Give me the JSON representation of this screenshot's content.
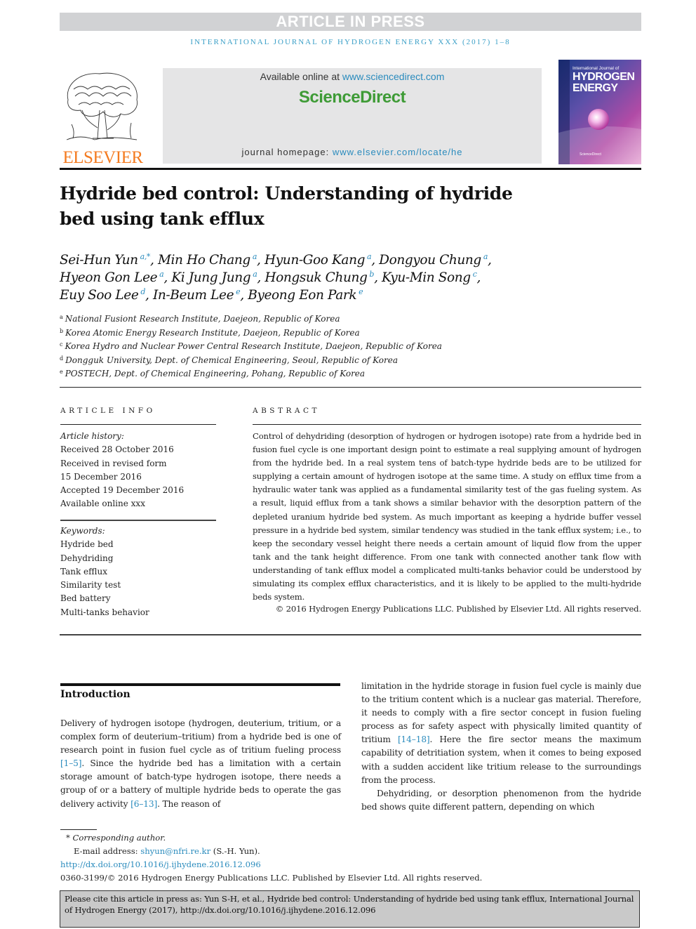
{
  "banner": {
    "label": "ARTICLE IN PRESS"
  },
  "journal_line": "International Journal of Hydrogen Energy xxx (2017) 1–8",
  "header": {
    "publisher_wordmark": "ELSEVIER",
    "available_prefix": "Available online at ",
    "available_link": "www.sciencedirect.com",
    "platform_logo": "ScienceDirect",
    "homepage_prefix": "journal homepage: ",
    "homepage_link": "www.elsevier.com/locate/he",
    "cover": {
      "line1": "International Journal of",
      "line2": "HYDROGEN",
      "line3": "ENERGY",
      "footer": "ScienceDirect"
    }
  },
  "title": {
    "line1": "Hydride bed control: Understanding of hydride",
    "line2": "bed using tank efflux"
  },
  "authors": [
    {
      "name": "Sei-Hun Yun",
      "aff": "a,*",
      "sep": ", "
    },
    {
      "name": "Min Ho Chang",
      "aff": "a",
      "sep": ", "
    },
    {
      "name": "Hyun-Goo Kang",
      "aff": "a",
      "sep": ", "
    },
    {
      "name": "Dongyou Chung",
      "aff": "a",
      "sep": ","
    },
    {
      "name": "Hyeon Gon Lee",
      "aff": "a",
      "sep": ", "
    },
    {
      "name": "Ki Jung Jung",
      "aff": "a",
      "sep": ", "
    },
    {
      "name": "Hongsuk Chung",
      "aff": "b",
      "sep": ", "
    },
    {
      "name": "Kyu-Min Song",
      "aff": "c",
      "sep": ","
    },
    {
      "name": "Euy Soo Lee",
      "aff": "d",
      "sep": ", "
    },
    {
      "name": "In-Beum Lee",
      "aff": "e",
      "sep": ", "
    },
    {
      "name": "Byeong Eon Park",
      "aff": "e",
      "sep": ""
    }
  ],
  "affiliations": [
    {
      "key": "a",
      "text": "National Fusiont Research Institute, Daejeon, Republic of Korea"
    },
    {
      "key": "b",
      "text": "Korea Atomic Energy Research Institute, Daejeon, Republic of Korea"
    },
    {
      "key": "c",
      "text": "Korea Hydro and Nuclear Power Central Research Institute, Daejeon, Republic of Korea"
    },
    {
      "key": "d",
      "text": "Dongguk University, Dept. of Chemical Engineering, Seoul, Republic of Korea"
    },
    {
      "key": "e",
      "text": "POSTECH, Dept. of Chemical Engineering, Pohang, Republic of Korea"
    }
  ],
  "article_info": {
    "heading": "ARTICLE INFO",
    "history_label": "Article history:",
    "history": [
      "Received 28 October 2016",
      "Received in revised form",
      "15 December 2016",
      "Accepted 19 December 2016",
      "Available online xxx"
    ],
    "keywords_label": "Keywords:",
    "keywords": [
      "Hydride bed",
      "Dehydriding",
      "Tank efflux",
      "Similarity test",
      "Bed battery",
      "Multi-tanks behavior"
    ]
  },
  "abstract": {
    "heading": "ABSTRACT",
    "text": "Control of dehydriding (desorption of hydrogen or hydrogen isotope) rate from a hydride bed in fusion fuel cycle is one important design point to estimate a real supplying amount of hydrogen from the hydride bed. In a real system tens of batch-type hydride beds are to be utilized for supplying a certain amount of hydrogen isotope at the same time. A study on efflux time from a hydraulic water tank was applied as a fundamental similarity test of the gas fueling system. As a result, liquid efflux from a tank shows a similar behavior with the desorption pattern of the depleted uranium hydride bed system. As much important as keeping a hydride buffer vessel pressure in a hydride bed system, similar tendency was studied in the tank efflux system; i.e., to keep the secondary vessel height there needs a certain amount of liquid flow from the upper tank and the tank height difference. From one tank with connected another tank flow with understanding of tank efflux model a complicated multi-tanks behavior could be understood by simulating its complex efflux characteristics, and it is likely to be applied to the multi-hydride beds system.",
    "copyright": "© 2016 Hydrogen Energy Publications LLC. Published by Elsevier Ltd. All rights reserved."
  },
  "introduction": {
    "heading": "Introduction",
    "p1_a": "Delivery of hydrogen isotope (hydrogen, deuterium, tritium, or a complex form of deuterium–tritium) from a hydride bed is one of research point in fusion fuel cycle as of tritium fueling process ",
    "p1_ref1": "[1–5]",
    "p1_b": ". Since the hydride bed has a limitation with a certain storage amount of batch-type hydrogen isotope, there needs a group of or a battery of multiple hydride beds to operate the gas delivery activity ",
    "p1_ref2": "[6–13]",
    "p1_c": ". The reason of limitation in the hydride storage in fusion fuel cycle is mainly due to the tritium content which is a nuclear gas material. Therefore, it needs to comply with a fire sector concept in fusion fueling process as for safety aspect with physically limited quantity of tritium ",
    "p1_ref3": "[14–18]",
    "p1_d": ". Here the fire sector means the maximum capability of detritiation system, when it comes to being exposed with a sudden accident like tritium release to the surroundings from the process.",
    "p2": "Dehydriding, or desorption phenomenon from the hydride bed shows quite different pattern, depending on which"
  },
  "footnotes": {
    "corresponding": "* Corresponding author.",
    "email_label": "E-mail address: ",
    "email": "shyun@nfri.re.kr",
    "email_suffix": " (S.-H. Yun).",
    "doi": "http://dx.doi.org/10.1016/j.ijhydene.2016.12.096",
    "issn_line": "0360-3199/© 2016 Hydrogen Energy Publications LLC. Published by Elsevier Ltd. All rights reserved."
  },
  "cite_box": {
    "text": "Please cite this article in press as: Yun S-H, et al., Hydride bed control: Understanding of hydride bed using tank efflux, International Journal of Hydrogen Energy (2017), http://dx.doi.org/10.1016/j.ijhydene.2016.12.096"
  },
  "colors": {
    "link": "#2a8bbd",
    "publisher_orange": "#f47b20",
    "platform_green": "#3e9b36",
    "banner_gray": "#d1d2d4"
  }
}
